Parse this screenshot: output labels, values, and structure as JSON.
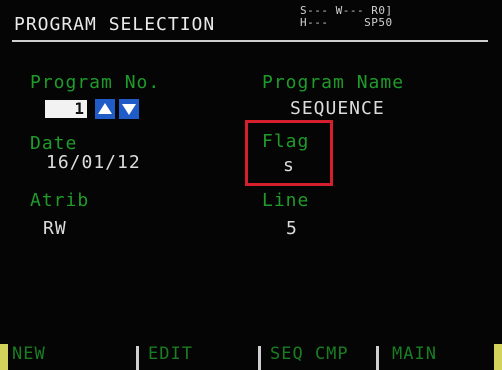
{
  "header": {
    "title": "PROGRAM SELECTION",
    "status_line1": "S--- W--- R0]",
    "status_line2": "H---     SP50"
  },
  "fields": {
    "program_no": {
      "label": "Program No.",
      "value": "1"
    },
    "program_name": {
      "label": "Program Name",
      "value": "SEQUENCE"
    },
    "date": {
      "label": "Date",
      "value": "16/01/12"
    },
    "flag": {
      "label": "Flag",
      "value": "s"
    },
    "atrib": {
      "label": "Atrib",
      "value": "RW"
    },
    "line": {
      "label": "Line",
      "value": "5"
    }
  },
  "softkeys": [
    "NEW",
    "EDIT",
    "SEQ CMP",
    "MAIN"
  ],
  "colors": {
    "label_green": "#1f9b2b",
    "value_white": "#dcdcdc",
    "highlight_red": "#d61f2d",
    "arrow_blue": "#1f5cc7"
  },
  "icons": {
    "up": "triangle-up-icon",
    "down": "triangle-down-icon"
  }
}
